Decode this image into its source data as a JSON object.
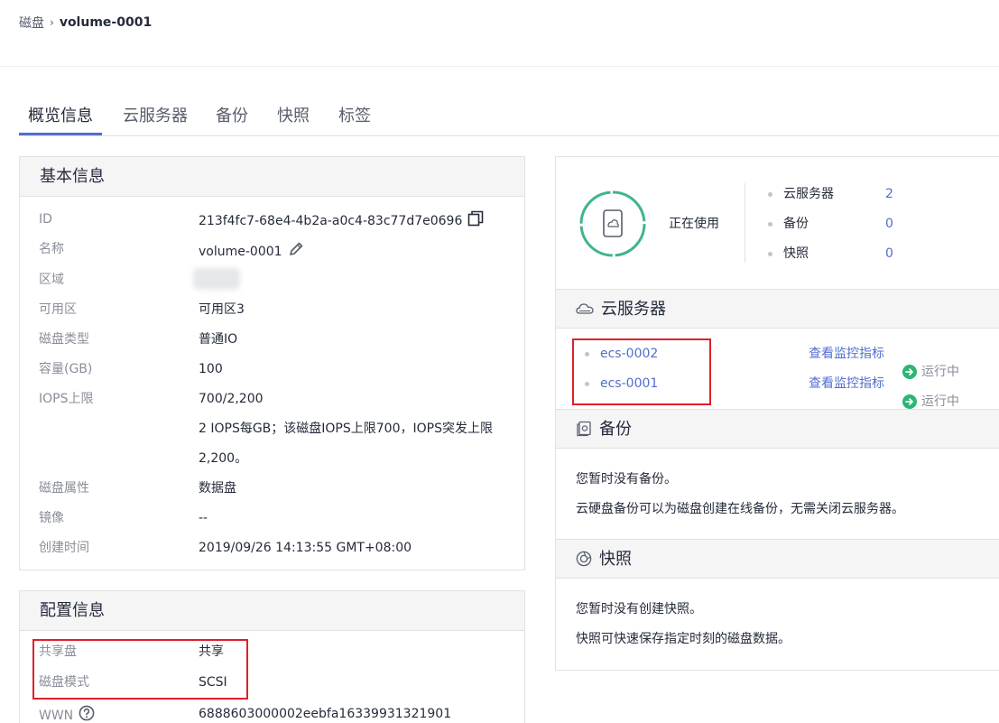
{
  "breadcrumb": {
    "parent": "磁盘",
    "separator": "›",
    "current": "volume-0001"
  },
  "tabs": [
    {
      "label": "概览信息",
      "active": true
    },
    {
      "label": "云服务器",
      "active": false
    },
    {
      "label": "备份",
      "active": false
    },
    {
      "label": "快照",
      "active": false
    },
    {
      "label": "标签",
      "active": false
    }
  ],
  "basic_info": {
    "title": "基本信息",
    "id_label": "ID",
    "id_value": "213f4fc7-68e4-4b2a-a0c4-83c77d7e0696",
    "name_label": "名称",
    "name_value": "volume-0001",
    "region_label": "区域",
    "az_label": "可用区",
    "az_value": "可用区3",
    "disk_type_label": "磁盘类型",
    "disk_type_value": "普通IO",
    "capacity_label": "容量(GB)",
    "capacity_value": "100",
    "iops_label": "IOPS上限",
    "iops_value": "700/2,200",
    "iops_note": "2 IOPS每GB；该磁盘IOPS上限700，IOPS突发上限2,200。",
    "attr_label": "磁盘属性",
    "attr_value": "数据盘",
    "image_label": "镜像",
    "image_value": "--",
    "created_label": "创建时间",
    "created_value": "2019/09/26 14:13:55 GMT+08:00"
  },
  "config_info": {
    "title": "配置信息",
    "shared_label": "共享盘",
    "shared_value": "共享",
    "mode_label": "磁盘模式",
    "mode_value": "SCSI",
    "wwn_label": "WWN",
    "wwn_value": "6888603000002eebfa16339931321901"
  },
  "usage": {
    "status": "正在使用",
    "stats": [
      {
        "label": "云服务器",
        "value": "2"
      },
      {
        "label": "备份",
        "value": "0"
      },
      {
        "label": "快照",
        "value": "0"
      }
    ]
  },
  "servers": {
    "title": "云服务器",
    "items": [
      {
        "name": "ecs-0002",
        "monitor": "查看监控指标",
        "status": "运行中"
      },
      {
        "name": "ecs-0001",
        "monitor": "查看监控指标",
        "status": "运行中"
      }
    ]
  },
  "backup": {
    "title": "备份",
    "empty": "您暂时没有备份。",
    "tip": "云硬盘备份可以为磁盘创建在线备份，无需关闭云服务器。"
  },
  "snapshot": {
    "title": "快照",
    "empty": "您暂时没有创建快照。",
    "tip": "快照可快速保存指定时刻的磁盘数据。"
  },
  "colors": {
    "accent": "#526ecc",
    "ring": "#3fb58c",
    "running": "#2bb674",
    "highlight": "#e0202a"
  }
}
